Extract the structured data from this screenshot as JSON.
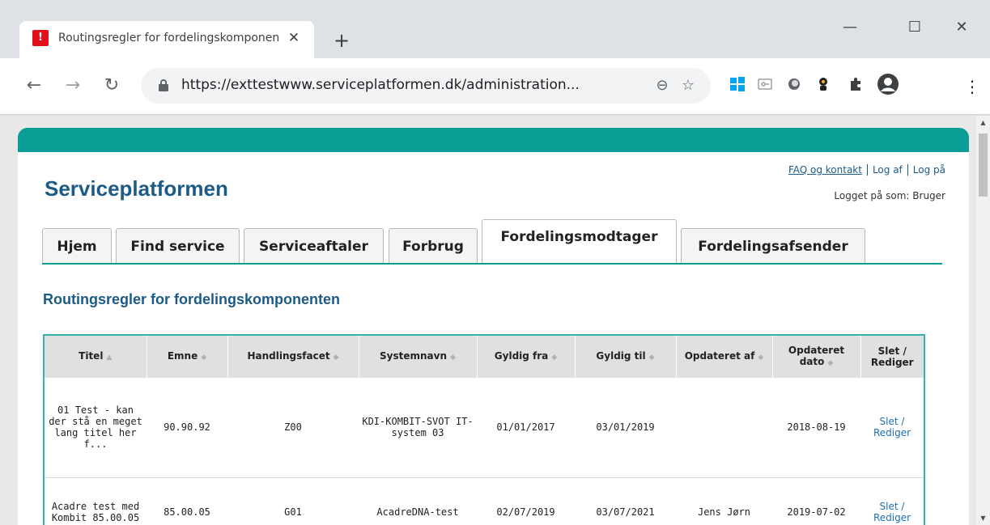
{
  "browser": {
    "tab_title": "Routingsregler for fordelingskomponenten",
    "tab_favicon": "!",
    "url": "https://exttestwww.serviceplatformen.dk/administration...",
    "buttons": {
      "close_tab": "✕",
      "new_tab": "+",
      "minimize": "—",
      "maximize": "☐",
      "close_window": "✕",
      "back": "←",
      "forward": "→",
      "reload": "↻",
      "zoom": "⊖",
      "bookmark": "☆",
      "menu": "⋮"
    }
  },
  "header": {
    "brand": "Serviceplatformen",
    "links": [
      "FAQ og kontakt",
      "Log af",
      "Log på"
    ],
    "logged_in": "Logget på som: Bruger"
  },
  "nav": {
    "tabs": [
      "Hjem",
      "Find service",
      "Serviceaftaler",
      "Forbrug",
      "Fordelingsmodtager",
      "Fordelingsafsender"
    ],
    "active": "Fordelingsmodtager"
  },
  "main": {
    "title": "Routingsregler for fordelingskomponenten",
    "columns": [
      "Titel",
      "Emne",
      "Handlingsfacet",
      "Systemnavn",
      "Gyldig fra",
      "Gyldig til",
      "Opdateret af",
      "Opdateret dato",
      "Slet / Rediger"
    ],
    "rows": [
      {
        "titel": "01 Test - kan der stå en meget lang titel her f...",
        "emne": "90.90.92",
        "handlingsfacet": "Z00",
        "systemnavn": "KDI-KOMBIT-SVOT IT-system 03",
        "gyldig_fra": "01/01/2017",
        "gyldig_til": "03/01/2019",
        "opdateret_af": "",
        "opdateret_dato": "2018-08-19",
        "slet": "Slet",
        "rediger": "Rediger"
      },
      {
        "titel": "Acadre test med Kombit 85.00.05",
        "emne": "85.00.05",
        "handlingsfacet": "G01",
        "systemnavn": "AcadreDNA-test",
        "gyldig_fra": "02/07/2019",
        "gyldig_til": "03/07/2021",
        "opdateret_af": "Jens Jørn",
        "opdateret_dato": "2019-07-02",
        "slet": "Slet",
        "rediger": "Rediger"
      }
    ]
  },
  "colors": {
    "accent": "#0a9e96",
    "brand": "#1c5b86",
    "link": "#1a6fb5"
  }
}
